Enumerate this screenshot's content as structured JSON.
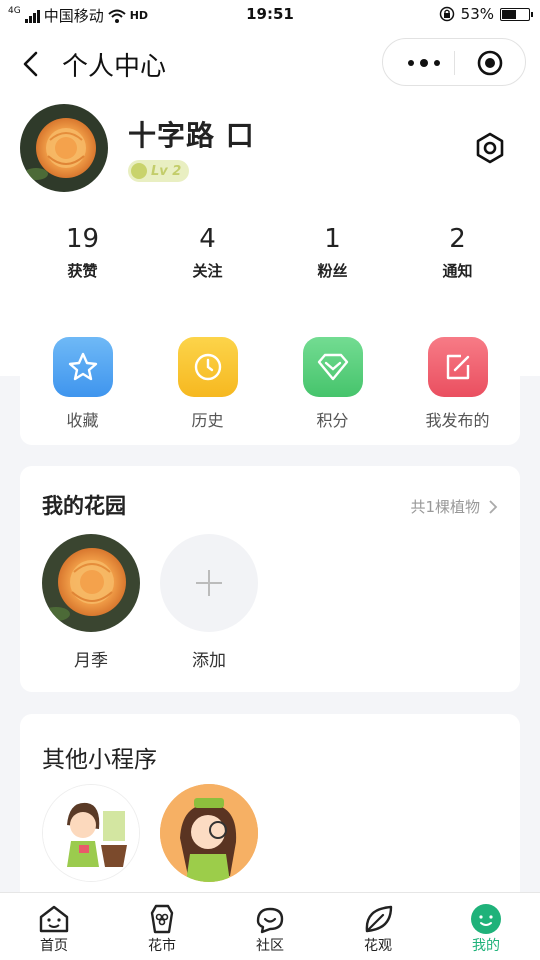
{
  "status_bar": {
    "carrier": "中国移动",
    "network": "4G",
    "volte": "HD",
    "time": "19:51",
    "battery": "53%",
    "battery_level": 0.53
  },
  "nav": {
    "title": "个人中心"
  },
  "profile": {
    "username": "十字路 口",
    "level": "Lv 2"
  },
  "stats": [
    {
      "num": "19",
      "label": "获赞"
    },
    {
      "num": "4",
      "label": "关注"
    },
    {
      "num": "1",
      "label": "粉丝"
    },
    {
      "num": "2",
      "label": "通知"
    }
  ],
  "quick_actions": [
    {
      "label": "收藏",
      "icon": "star-icon",
      "color": "#5aa7f2"
    },
    {
      "label": "历史",
      "icon": "clock-icon",
      "color": "#f9c632"
    },
    {
      "label": "积分",
      "icon": "diamond-icon",
      "color": "#5ed27f"
    },
    {
      "label": "我发布的",
      "icon": "edit-icon",
      "color": "#f26775"
    }
  ],
  "garden": {
    "title": "我的花园",
    "count": "共1棵植物",
    "plants": [
      {
        "name": "月季"
      }
    ],
    "add_label": "添加"
  },
  "other_apps": {
    "title": "其他小程序"
  },
  "tabbar": [
    {
      "label": "首页",
      "icon": "home-icon"
    },
    {
      "label": "花市",
      "icon": "market-icon"
    },
    {
      "label": "社区",
      "icon": "community-icon"
    },
    {
      "label": "花观",
      "icon": "leaf-icon"
    },
    {
      "label": "我的",
      "icon": "profile-icon",
      "active": true
    }
  ],
  "colors": {
    "accent_green": "#1fb27a",
    "page_bg": "#f4f5f8"
  }
}
